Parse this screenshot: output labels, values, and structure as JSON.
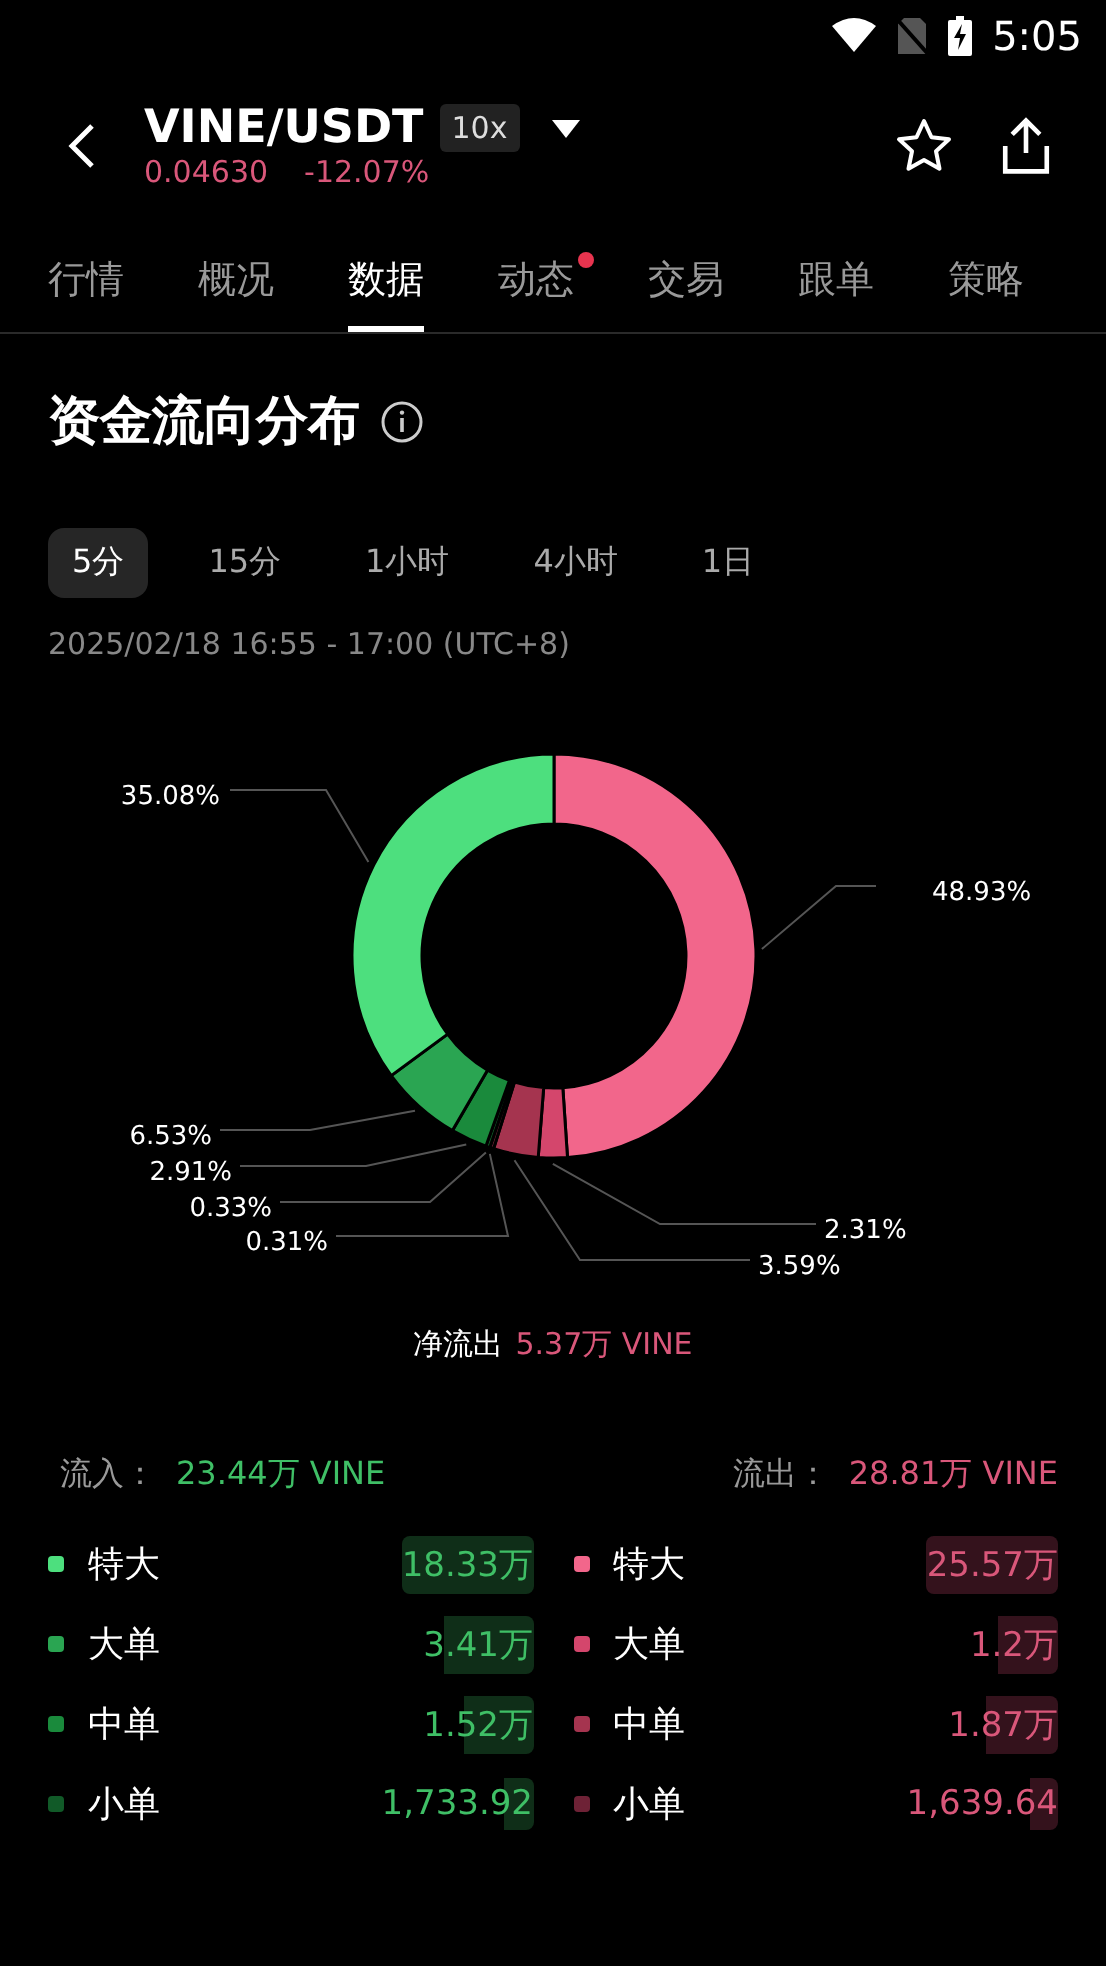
{
  "status_bar": {
    "time": "5:05"
  },
  "header": {
    "pair": "VINE/USDT",
    "leverage": "10x",
    "price": "0.04630",
    "change": "-12.07%"
  },
  "tabs": [
    {
      "label": "行情",
      "selected": false,
      "dot": false
    },
    {
      "label": "概况",
      "selected": false,
      "dot": false
    },
    {
      "label": "数据",
      "selected": true,
      "dot": false
    },
    {
      "label": "动态",
      "selected": false,
      "dot": true
    },
    {
      "label": "交易",
      "selected": false,
      "dot": false
    },
    {
      "label": "跟单",
      "selected": false,
      "dot": false
    },
    {
      "label": "策略",
      "selected": false,
      "dot": false
    }
  ],
  "section": {
    "title": "资金流向分布",
    "periods": [
      {
        "label": "5分",
        "selected": true
      },
      {
        "label": "15分",
        "selected": false
      },
      {
        "label": "1小时",
        "selected": false
      },
      {
        "label": "4小时",
        "selected": false
      },
      {
        "label": "1日",
        "selected": false
      }
    ],
    "date_range": "2025/02/18 16:55 - 17:00 (UTC+8)",
    "chart_data": {
      "type": "donut",
      "series": [
        {
          "values": [
            48.93,
            2.31,
            3.59,
            0.31,
            0.33,
            2.91,
            6.53,
            35.08
          ]
        }
      ],
      "colors": [
        "#f2668b",
        "#d4466c",
        "#a5344f",
        "#6e2236",
        "#115a28",
        "#1a8a3c",
        "#2aa552",
        "#4ddf7e"
      ],
      "value_labels": [
        "48.93%",
        "2.31%",
        "3.59%",
        "0.31%",
        "0.33%",
        "2.91%",
        "6.53%",
        "35.08%"
      ]
    },
    "net": {
      "label": "净流出",
      "value": "5.37万 VINE"
    },
    "inflow": {
      "label": "流入：",
      "total": "23.44万 VINE",
      "items": [
        {
          "name": "特大",
          "value": "18.33万",
          "color": "#4ddf7e"
        },
        {
          "name": "大单",
          "value": "3.41万",
          "color": "#2aa552"
        },
        {
          "name": "中单",
          "value": "1.52万",
          "color": "#1a8a3c"
        },
        {
          "name": "小单",
          "value": "1,733.92",
          "color": "#115a28"
        }
      ]
    },
    "outflow": {
      "label": "流出：",
      "total": "28.81万 VINE",
      "items": [
        {
          "name": "特大",
          "value": "25.57万",
          "color": "#f2668b"
        },
        {
          "name": "大单",
          "value": "1.2万",
          "color": "#d4466c"
        },
        {
          "name": "中单",
          "value": "1.87万",
          "color": "#a5344f"
        },
        {
          "name": "小单",
          "value": "1,639.64",
          "color": "#6e2236"
        }
      ]
    }
  }
}
